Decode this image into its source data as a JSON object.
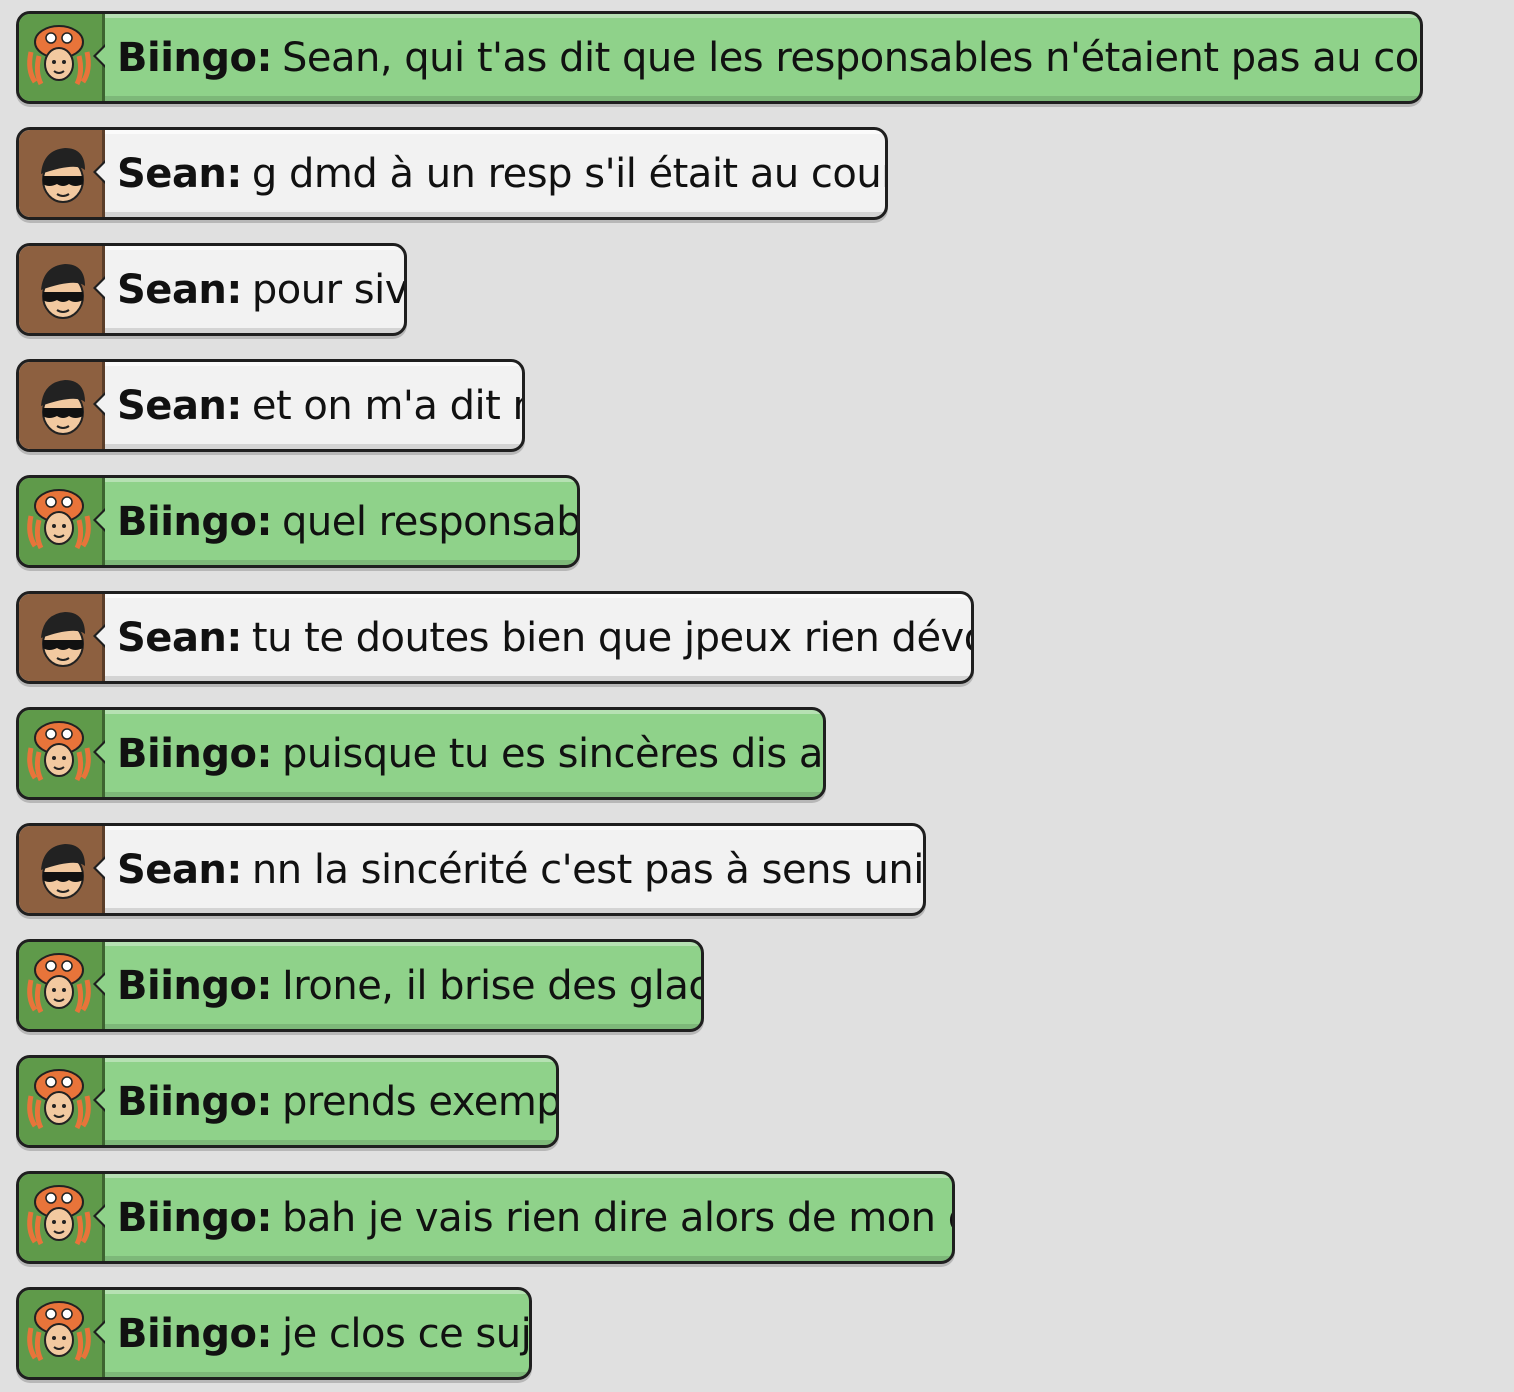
{
  "messages": [
    {
      "user": "Biingo:",
      "text": "Sean, qui t'as dit que les responsables n'étaient pas au courant ?",
      "style": "green",
      "avatar": "octopus-hat-avatar-icon"
    },
    {
      "user": "Sean:",
      "text": "g dmd à un resp s'il était au courant",
      "style": "white",
      "avatar": "sunglasses-avatar-icon"
    },
    {
      "user": "Sean:",
      "text": "pour sive",
      "style": "white",
      "avatar": "sunglasses-avatar-icon"
    },
    {
      "user": "Sean:",
      "text": "et on m'a dit nn",
      "style": "white",
      "avatar": "sunglasses-avatar-icon"
    },
    {
      "user": "Biingo:",
      "text": "quel responsable",
      "style": "green",
      "avatar": "octopus-hat-avatar-icon"
    },
    {
      "user": "Sean:",
      "text": "tu te doutes bien que jpeux rien dévoiler",
      "style": "white",
      "avatar": "sunglasses-avatar-icon"
    },
    {
      "user": "Biingo:",
      "text": "puisque tu es sincères dis alors",
      "style": "green",
      "avatar": "octopus-hat-avatar-icon"
    },
    {
      "user": "Sean:",
      "text": "nn la sincérité c'est pas à sens unique!",
      "style": "white",
      "avatar": "sunglasses-avatar-icon"
    },
    {
      "user": "Biingo:",
      "text": "Irone, il brise des glaces",
      "style": "green",
      "avatar": "octopus-hat-avatar-icon"
    },
    {
      "user": "Biingo:",
      "text": "prends exemple",
      "style": "green",
      "avatar": "octopus-hat-avatar-icon"
    },
    {
      "user": "Biingo:",
      "text": "bah je vais rien dire alors de mon coté",
      "style": "green",
      "avatar": "octopus-hat-avatar-icon"
    },
    {
      "user": "Biingo:",
      "text": "je clos ce sujet",
      "style": "green",
      "avatar": "octopus-hat-avatar-icon"
    }
  ],
  "colors": {
    "background": "#e0e0e0",
    "green_bubble": "#8fd28a",
    "green_avatar_bg": "#5f9a4a",
    "white_bubble": "#f2f2f2",
    "brown_avatar_bg": "#8d6040"
  }
}
